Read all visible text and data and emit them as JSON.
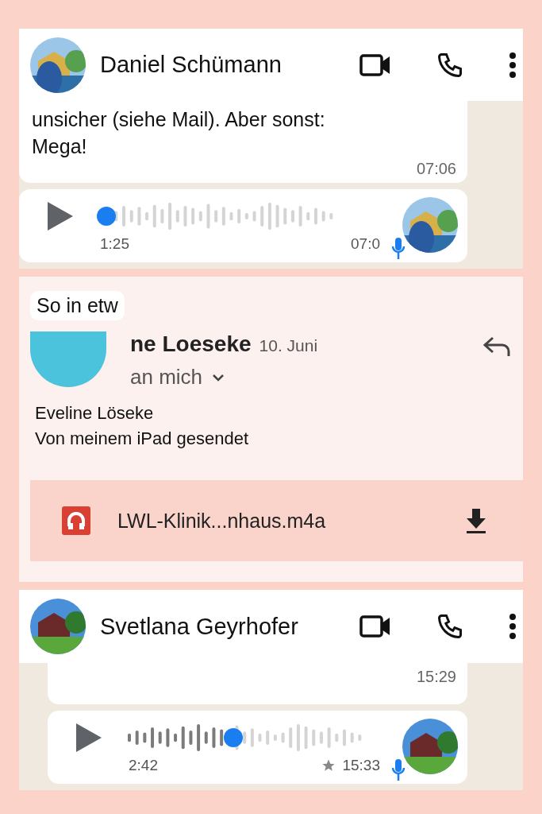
{
  "chats": [
    {
      "header": {
        "name": "Daniel Schümann"
      },
      "messages": [
        {
          "kind": "text",
          "lines": [
            "unsicher (siehe Mail). Aber sonst:",
            "Mega!"
          ],
          "time": "07:06"
        },
        {
          "kind": "voice",
          "duration": "1:25",
          "time": "07:0",
          "starred": false
        }
      ]
    },
    {
      "header": {
        "name": "Svetlana Geyrhofer"
      },
      "messages": [
        {
          "kind": "text",
          "time": "15:29"
        },
        {
          "kind": "voice",
          "duration": "2:42",
          "time": "15:33",
          "level": 0.45,
          "starred": true
        }
      ]
    }
  ],
  "email": {
    "quote": "So in etw",
    "sender": "ne Loeseke",
    "date": "10. Juni",
    "recipient": "an mich",
    "body": [
      "Eveline Löseke",
      "Von meinem iPad gesendet"
    ],
    "attachment": {
      "name": "LWL-Klinik...nhaus.m4a"
    }
  }
}
